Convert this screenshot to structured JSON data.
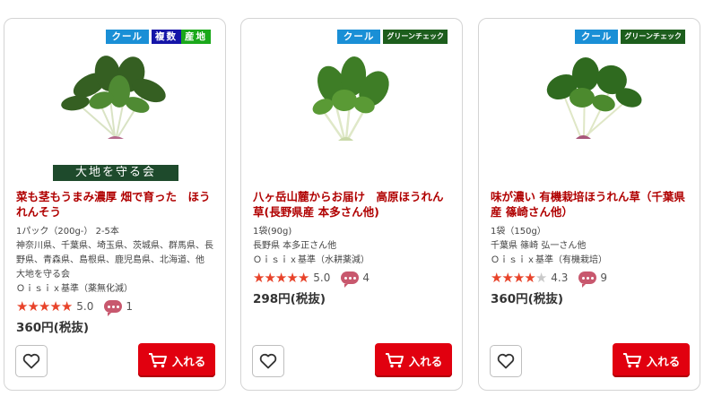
{
  "colors": {
    "accent_red": "#e1000f",
    "title_red": "#b00000",
    "star": "#e8432a",
    "cool_tag": "#1a8fd6"
  },
  "products": [
    {
      "tags": {
        "cool": "クール",
        "multi_origin_a": "複数",
        "multi_origin_b": "産地"
      },
      "image_label": "大地を守る会",
      "title": "菜も茎もうまみ濃厚 畑で育った　ほうれんそう",
      "lines": [
        "1パック（200g-） 2-5本",
        "神奈川県、千葉県、埼玉県、茨城県、群馬県、長野県、青森県、島根県、鹿児島県、北海道、他 大地を守る会",
        "Ｏｉｓｉｘ基準（薬無化減）"
      ],
      "rating": 5.0,
      "rating_text": "5.0",
      "reviews": "1",
      "price": "360円(税抜)",
      "cart_label": "入れる",
      "icons": {
        "favorite": "heart-icon",
        "cart": "cart-icon",
        "review": "comment-icon"
      }
    },
    {
      "tags": {
        "cool": "クール",
        "green": "グリーンチェック"
      },
      "title": "八ヶ岳山麓からお届け　高原ほうれん草(長野県産 本多さん他)",
      "lines": [
        "1袋(90g)",
        "長野県 本多正さん他",
        "Ｏｉｓｉｘ基準（水耕薬減）"
      ],
      "rating": 5.0,
      "rating_text": "5.0",
      "reviews": "4",
      "price": "298円(税抜)",
      "cart_label": "入れる",
      "icons": {
        "favorite": "heart-icon",
        "cart": "cart-icon",
        "review": "comment-icon"
      }
    },
    {
      "tags": {
        "cool": "クール",
        "green": "グリーンチェック"
      },
      "title": "味が濃い 有機栽培ほうれん草（千葉県産 篠崎さん他）",
      "lines": [
        "1袋（150g）",
        "千葉県 篠崎 弘一さん他",
        "Ｏｉｓｉｘ基準（有機栽培）"
      ],
      "rating": 4.3,
      "rating_text": "4.3",
      "reviews": "9",
      "price": "360円(税抜)",
      "cart_label": "入れる",
      "icons": {
        "favorite": "heart-icon",
        "cart": "cart-icon",
        "review": "comment-icon"
      }
    }
  ]
}
